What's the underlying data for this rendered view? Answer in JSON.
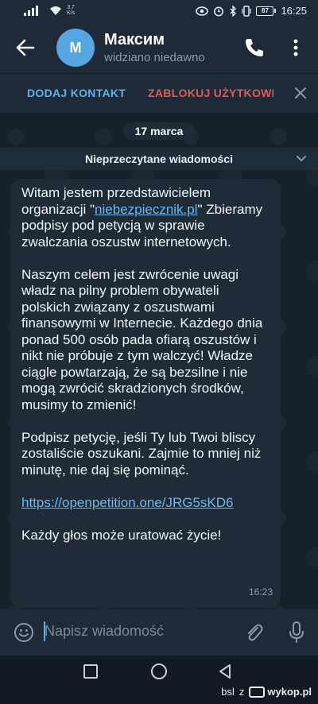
{
  "status_bar": {
    "speed_value": "3,7",
    "speed_unit": "K/s",
    "battery": "87",
    "time": "16:25"
  },
  "header": {
    "avatar_letter": "M",
    "name": "Максим",
    "status": "widziano niedawno"
  },
  "action_bar": {
    "add_contact": "DODAJ KONTAKT",
    "block_user": "ZABLOKUJ UŻYTKOWNIKA"
  },
  "chat": {
    "date": "17 marca",
    "unread_label": "Nieprzeczytane wiadomości",
    "message": {
      "p1_before": "Witam jestem przedstawicielem organizacji \"",
      "p1_link": "niebezpiecznik.pl",
      "p1_after": "\"  Zbieramy podpisy pod petycją w sprawie zwalczania oszustw internetowych.",
      "p2": " Naszym celem jest zwrócenie uwagi władz na pilny problem obywateli polskich związany z oszustwami finansowymi w Internecie.  Każdego dnia ponad 500 osób pada ofiarą oszustów i nikt nie próbuje z tym walczyć!  Władze ciągle powtarzają, że są bezsilne i nie mogą zwrócić skradzionych środków, musimy to zmienić!",
      "p3": " Podpisz petycję, jeśli Ty lub Twoi bliscy zostaliście oszukani.  Zajmie to mniej niż minutę, nie daj się pominąć.",
      "link": "https://openpetition.one/JRG5sKD6",
      "p4": "Każdy głos może uratować życie!",
      "time": "16:23"
    }
  },
  "input": {
    "placeholder": "Napisz wiadomość"
  },
  "watermark": {
    "user": "bsl",
    "z": "z",
    "site": "wykop.pl"
  },
  "colors": {
    "accent": "#5ab3f0",
    "danger": "#e45a5a",
    "bubble": "#1f2c38",
    "header": "#1e2a37"
  }
}
